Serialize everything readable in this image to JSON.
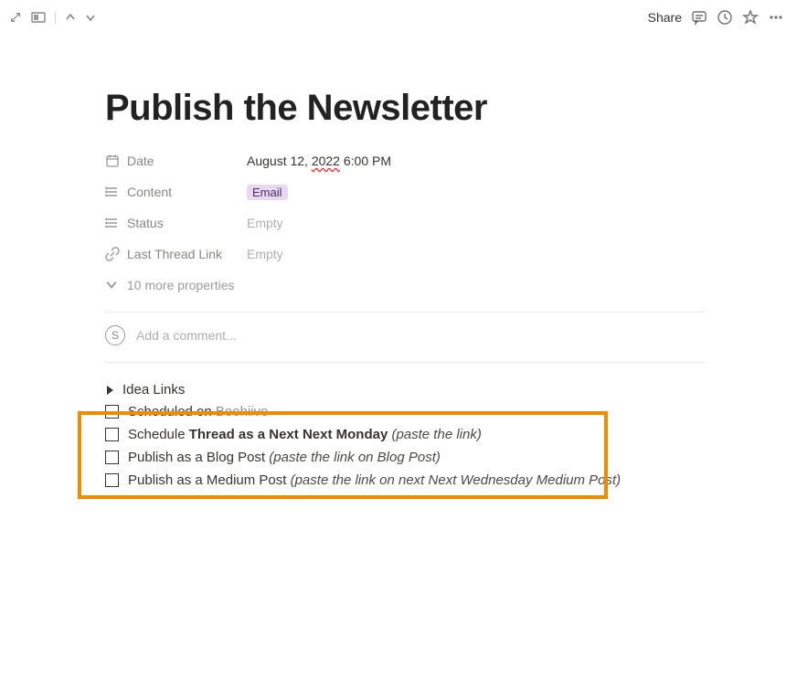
{
  "topbar": {
    "share_label": "Share"
  },
  "title": "Publish the Newsletter",
  "properties": {
    "date": {
      "label": "Date",
      "month_day": "August 12, ",
      "year": "2022",
      "time": " 6:00 PM"
    },
    "content": {
      "label": "Content",
      "tag": "Email"
    },
    "status": {
      "label": "Status",
      "value": "Empty"
    },
    "last_thread_link": {
      "label": "Last Thread Link",
      "value": "Empty"
    },
    "more": "10 more properties"
  },
  "comment": {
    "avatar_initial": "S",
    "placeholder": "Add a comment..."
  },
  "content_blocks": {
    "toggle": "Idea Links",
    "todo1": {
      "text": "Scheduled on ",
      "link": "Beehiive"
    },
    "todo2": {
      "text1": "Schedule ",
      "bold": "Thread as a Next Next Monday ",
      "italic": "(paste the link)"
    },
    "todo3": {
      "text": "Publish as a Blog Post ",
      "italic": "(paste the link on Blog Post)"
    },
    "todo4": {
      "text": "Publish as a Medium Post ",
      "italic": "(paste the link on next Next Wednesday Medium Post)"
    }
  }
}
